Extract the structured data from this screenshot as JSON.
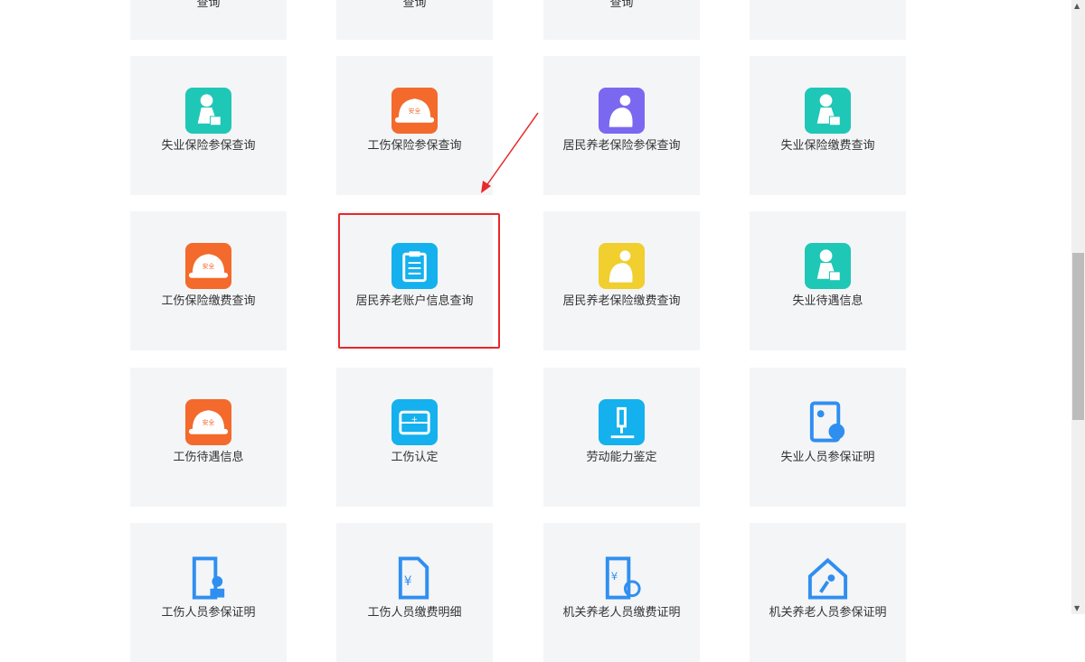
{
  "top_row": [
    "查询",
    "查询",
    "查询",
    ""
  ],
  "cards": [
    {
      "label": "失业保险参保查询",
      "icon": "worker-icon",
      "color": "#1fc7b6"
    },
    {
      "label": "工伤保险参保查询",
      "icon": "safety-helmet-icon",
      "color": "#f36a2c"
    },
    {
      "label": "居民养老保险参保查询",
      "icon": "elder-icon",
      "color": "#7a68f0"
    },
    {
      "label": "失业保险缴费查询",
      "icon": "worker-icon",
      "color": "#1fc7b6"
    },
    {
      "label": "工伤保险缴费查询",
      "icon": "safety-helmet-icon",
      "color": "#f36a2c"
    },
    {
      "label": "居民养老账户信息查询",
      "icon": "clipboard-icon",
      "color": "#14b1ee"
    },
    {
      "label": "居民养老保险缴费查询",
      "icon": "elder-icon",
      "color": "#f0cf2e"
    },
    {
      "label": "失业待遇信息",
      "icon": "worker-icon",
      "color": "#1fc7b6"
    },
    {
      "label": "工伤待遇信息",
      "icon": "safety-helmet-icon",
      "color": "#f36a2c"
    },
    {
      "label": "工伤认定",
      "icon": "ambulance-icon",
      "color": "#14b1ee"
    },
    {
      "label": "劳动能力鉴定",
      "icon": "microscope-icon",
      "color": "#14b1ee"
    },
    {
      "label": "失业人员参保证明",
      "icon": "id-card-icon",
      "color": "#2f8ff0"
    },
    {
      "label": "工伤人员参保证明",
      "icon": "door-person-icon",
      "color": "#2f8ff0"
    },
    {
      "label": "工伤人员缴费明细",
      "icon": "yuan-document-icon",
      "color": "#2f8ff0"
    },
    {
      "label": "机关养老人员缴费证明",
      "icon": "yuan-badge-icon",
      "color": "#2f8ff0"
    },
    {
      "label": "机关养老人员参保证明",
      "icon": "house-person-icon",
      "color": "#2f8ff0"
    }
  ],
  "helmet_text": "安全"
}
